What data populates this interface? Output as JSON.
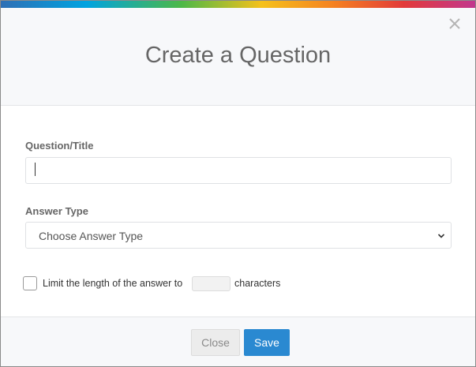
{
  "dialog": {
    "title": "Create a Question",
    "close_icon": "close-icon",
    "accent_colors": [
      "#2f6fb5",
      "#00a3e0",
      "#4cb848",
      "#f5c11b",
      "#f58220",
      "#e23a3a",
      "#c2378e"
    ]
  },
  "form": {
    "question_label": "Question/Title",
    "question_value": "",
    "answer_type_label": "Answer Type",
    "answer_type_selected": "Choose Answer Type",
    "limit_text_before": "Limit the length of the answer to",
    "limit_value": "",
    "limit_text_after": "characters",
    "limit_checked": false
  },
  "footer": {
    "close_label": "Close",
    "save_label": "Save",
    "save_color": "#2a89d1"
  }
}
